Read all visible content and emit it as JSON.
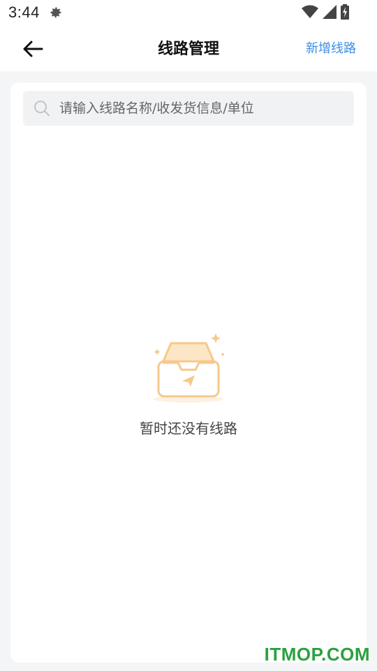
{
  "status_bar": {
    "time": "3:44",
    "icons": [
      "gear-icon",
      "wifi-icon",
      "signal-icon",
      "battery-charging-icon"
    ]
  },
  "header": {
    "title": "线路管理",
    "back_icon": "arrow-left-icon",
    "add_label": "新增线路"
  },
  "search": {
    "placeholder": "请输入线路名称/收发货信息/单位",
    "value": ""
  },
  "empty_state": {
    "icon": "empty-inbox-icon",
    "message": "暂时还没有线路"
  },
  "watermark": "ITMOP.COM",
  "colors": {
    "accent": "#3a8ee6",
    "empty_icon": "#f6c889",
    "watermark": "#2aa13f"
  }
}
